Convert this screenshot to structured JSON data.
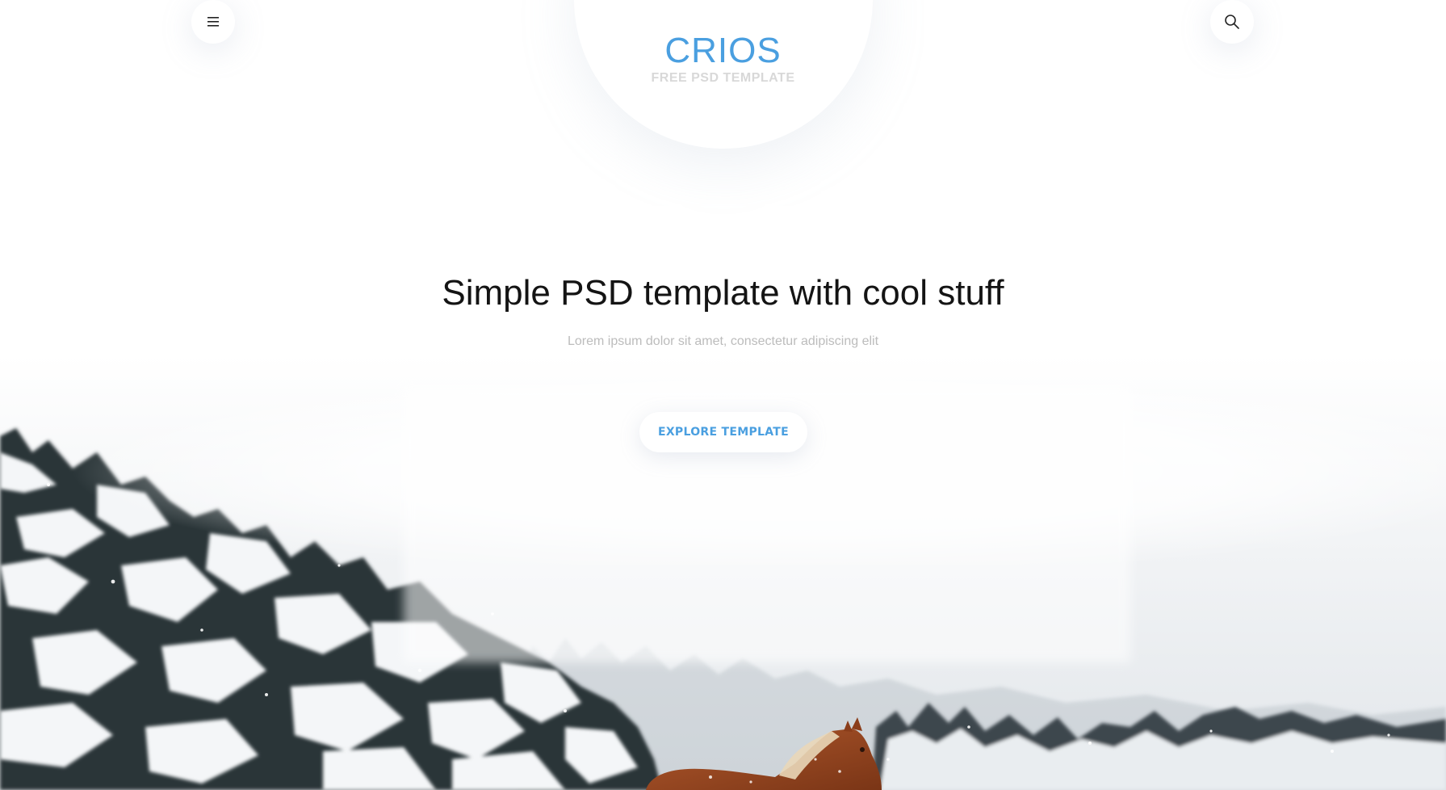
{
  "header": {
    "menu_icon": "hamburger-menu-icon",
    "search_icon": "search-icon",
    "logo": {
      "title": "CRIOS",
      "subtitle": "FREE PSD TEMPLATE"
    }
  },
  "hero": {
    "title": "Simple PSD template with cool stuff",
    "subtitle": "Lorem ipsum dolor sit amet, consectetur adipiscing elit",
    "cta_label": "EXPLORE TEMPLATE"
  },
  "colors": {
    "accent": "#4a9fe0",
    "heading": "#141414",
    "muted": "#bcbcbc",
    "background": "#ffffff"
  }
}
